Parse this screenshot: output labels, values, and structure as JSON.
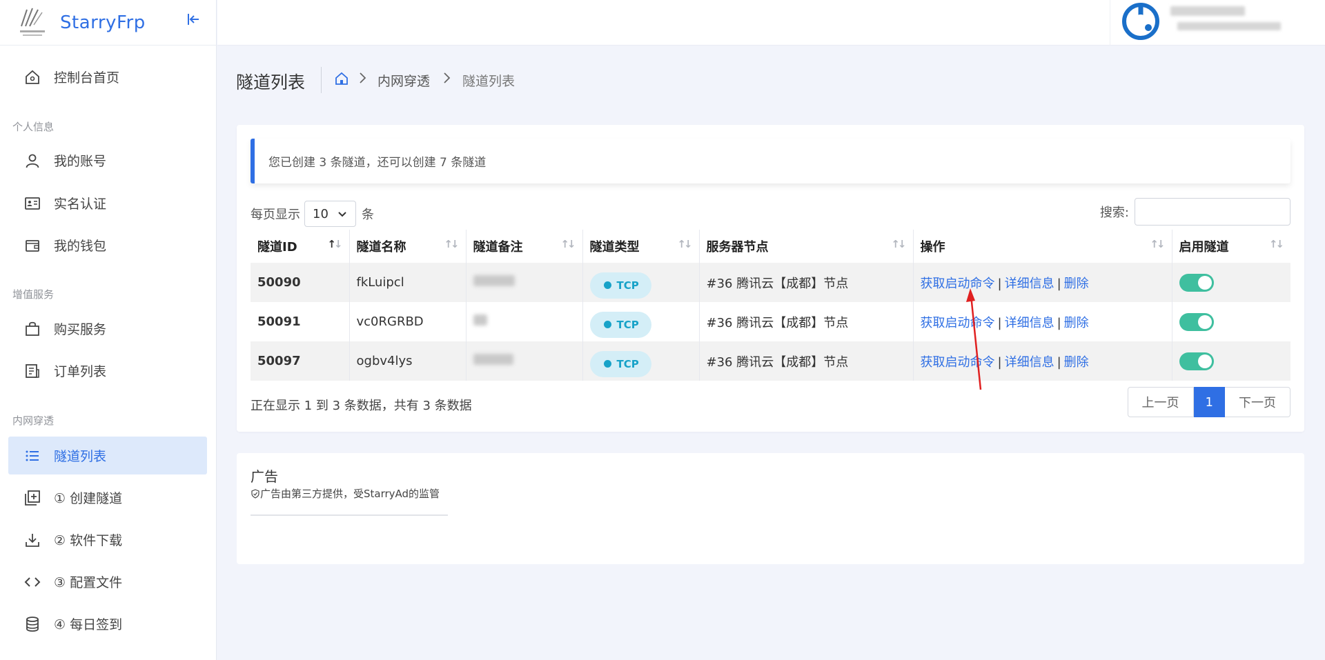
{
  "app": {
    "name": "StarryFrp"
  },
  "sidebar": {
    "items": [
      {
        "label": "控制台首页",
        "icon": "home-icon"
      },
      {
        "label": "我的账号",
        "icon": "user-icon"
      },
      {
        "label": "实名认证",
        "icon": "id-card-icon"
      },
      {
        "label": "我的钱包",
        "icon": "wallet-icon"
      },
      {
        "label": "购买服务",
        "icon": "shopping-bag-icon"
      },
      {
        "label": "订单列表",
        "icon": "receipt-icon"
      },
      {
        "label": "隧道列表",
        "icon": "list-icon",
        "active": true
      },
      {
        "label": "① 创建隧道",
        "icon": "add-square-icon"
      },
      {
        "label": "② 软件下载",
        "icon": "download-icon"
      },
      {
        "label": "③ 配置文件",
        "icon": "code-icon"
      },
      {
        "label": "④ 每日签到",
        "icon": "database-icon"
      }
    ],
    "sections": [
      "个人信息",
      "增值服务",
      "内网穿透"
    ]
  },
  "page": {
    "title": "隧道列表",
    "breadcrumb": [
      "内网穿透",
      "隧道列表"
    ]
  },
  "alert": {
    "text": "您已创建 3 条隧道，还可以创建 7 条隧道"
  },
  "table_controls": {
    "perpage_prefix": "每页显示",
    "perpage_value": "10",
    "perpage_suffix": "条",
    "search_label": "搜索:",
    "search_value": ""
  },
  "table": {
    "headers": [
      "隧道ID",
      "隧道名称",
      "隧道备注",
      "隧道类型",
      "服务器节点",
      "操作",
      "启用隧道"
    ],
    "rows": [
      {
        "id": "50090",
        "name": "fkLuipcl",
        "type": "TCP",
        "node": "#36 腾讯云【成都】节点",
        "enabled": true
      },
      {
        "id": "50091",
        "name": "vc0RGRBD",
        "type": "TCP",
        "node": "#36 腾讯云【成都】节点",
        "enabled": true
      },
      {
        "id": "50097",
        "name": "ogbv4lys",
        "type": "TCP",
        "node": "#36 腾讯云【成都】节点",
        "enabled": true
      }
    ],
    "actions": {
      "cmd": "获取启动命令",
      "detail": "详细信息",
      "delete": "删除",
      "separator": "|"
    }
  },
  "footer": {
    "info": "正在显示 1 到 3 条数据，共有 3 条数据",
    "prev": "上一页",
    "current": "1",
    "next": "下一页"
  },
  "ad": {
    "title": "广告",
    "subtitle": "广告由第三方提供，受StarryAd的监管"
  },
  "colors": {
    "primary": "#2f6fe4",
    "toggle": "#3fbf9f",
    "tcp": "#17a2c8",
    "annotation": "#e02020"
  }
}
